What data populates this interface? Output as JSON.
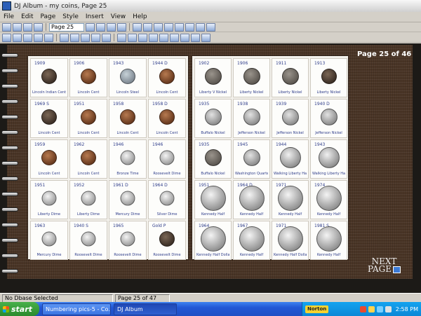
{
  "window": {
    "title": "DJ Album - my coins, Page 25"
  },
  "menu": [
    "File",
    "Edit",
    "Page",
    "Style",
    "Insert",
    "View",
    "Help"
  ],
  "toolbar": {
    "page_selector": "Page 25"
  },
  "page_indicator": "Page 25 of 46",
  "next_page": {
    "line1": "NEXT",
    "line2": "PAGE"
  },
  "album": {
    "left": [
      {
        "date": "1909",
        "label": "Lincoln Indian Cent",
        "coin": "dark"
      },
      {
        "date": "1906",
        "label": "Lincoln Cent",
        "coin": "copper"
      },
      {
        "date": "1943",
        "label": "Lincoln Steel",
        "coin": "steel"
      },
      {
        "date": "1944 D",
        "label": "Lincoln Cent",
        "coin": "copper"
      },
      {
        "date": "1969 S",
        "label": "Lincoln Cent",
        "coin": "dark"
      },
      {
        "date": "1951",
        "label": "Lincoln Cent",
        "coin": "copper"
      },
      {
        "date": "1958",
        "label": "Lincoln Cent",
        "coin": "copper"
      },
      {
        "date": "1958 D",
        "label": "Lincoln Cent",
        "coin": "copper"
      },
      {
        "date": "1959",
        "label": "Lincoln Cent",
        "coin": "copper"
      },
      {
        "date": "1962",
        "label": "Lincoln Cent",
        "coin": "copper"
      },
      {
        "date": "1946",
        "label": "Bronze Time",
        "coin": "silver-s"
      },
      {
        "date": "1946",
        "label": "Roosevelt Dime",
        "coin": "silver-s"
      },
      {
        "date": "1951",
        "label": "Liberty Dime",
        "coin": "silver-s"
      },
      {
        "date": "1952",
        "label": "Liberty Dime",
        "coin": "silver-s"
      },
      {
        "date": "1961 D",
        "label": "Mercury Dime",
        "coin": "silver-s"
      },
      {
        "date": "1964 D",
        "label": "Silver Dime",
        "coin": "silver-s"
      },
      {
        "date": "1963",
        "label": "Mercury Dime",
        "coin": "silver-s"
      },
      {
        "date": "1940 S",
        "label": "Roosevelt Dime",
        "coin": "silver-s"
      },
      {
        "date": "1965",
        "label": "Roosevelt Dime",
        "coin": "silver-s"
      },
      {
        "date": "Gold P",
        "label": "Roosevelt Dime",
        "coin": "dark"
      }
    ],
    "right": [
      {
        "date": "1902",
        "label": "Liberty V Nickel",
        "coin": "grey-nk"
      },
      {
        "date": "1906",
        "label": "Liberty Nickel",
        "coin": "grey-nk"
      },
      {
        "date": "1911",
        "label": "Liberty Nickel",
        "coin": "grey-nk"
      },
      {
        "date": "1913",
        "label": "Liberty Nickel",
        "coin": "dark"
      },
      {
        "date": "1935",
        "label": "Buffalo Nickel",
        "coin": "nickel"
      },
      {
        "date": "1938",
        "label": "Jefferson Nickel",
        "coin": "nickel"
      },
      {
        "date": "1939",
        "label": "Jefferson Nickel",
        "coin": "nickel"
      },
      {
        "date": "1940 D",
        "label": "Jefferson Nickel",
        "coin": "nickel"
      },
      {
        "date": "1935",
        "label": "Buffalo Nickel",
        "coin": "grey-nk"
      },
      {
        "date": "1945",
        "label": "Washington Quarter",
        "coin": "nickel"
      },
      {
        "date": "1944",
        "label": "Walking Liberty Half",
        "coin": "quarter"
      },
      {
        "date": "1943",
        "label": "Walking Liberty Half",
        "coin": "quarter"
      },
      {
        "date": "1951",
        "label": "Kennedy Half",
        "coin": "half"
      },
      {
        "date": "1964 D",
        "label": "Kennedy Half",
        "coin": "half"
      },
      {
        "date": "1971",
        "label": "Kennedy Half",
        "coin": "half"
      },
      {
        "date": "1974",
        "label": "Kennedy Half",
        "coin": "half"
      },
      {
        "date": "1964",
        "label": "Kennedy Half Dollar",
        "coin": "half"
      },
      {
        "date": "1967",
        "label": "Kennedy Half",
        "coin": "half"
      },
      {
        "date": "1971",
        "label": "Kennedy Half Dollar",
        "coin": "half"
      },
      {
        "date": "1981 S",
        "label": "Kennedy Half",
        "coin": "half"
      }
    ]
  },
  "status": {
    "left": "No Dbase Selected",
    "page": "Page 25 of 47"
  },
  "taskbar": {
    "start": "start",
    "tasks": [
      "Numbering pics-5 - Co...",
      "DJ Album"
    ],
    "norton": "Norton",
    "clock": "2:58 PM"
  }
}
